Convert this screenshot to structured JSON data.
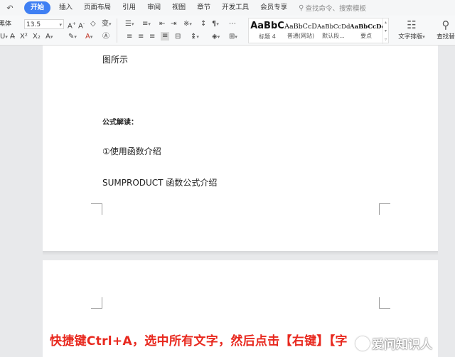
{
  "menubar": {
    "quick_icon": "↶",
    "tabs": [
      "开始",
      "插入",
      "页面布局",
      "引用",
      "审阅",
      "视图",
      "章节",
      "开发工具",
      "会员专享"
    ],
    "active_tab": "开始",
    "search_placeholder": "查找命令、搜索模板"
  },
  "ribbon": {
    "font_name": "黑体",
    "font_size": "13.5",
    "styles": [
      {
        "sample": "AaBbC",
        "name": "标题 4"
      },
      {
        "sample": "AaBbCcD",
        "name": "普通(网站)"
      },
      {
        "sample": "AaBbCcDd",
        "name": "默认段..."
      },
      {
        "sample": "AaBbCcDc",
        "name": "要点"
      }
    ],
    "text_layout_label": "文字排版",
    "find_replace_label": "查找替"
  },
  "document": {
    "lines": [
      "图所示",
      "公式解读：",
      "①使用函数介绍",
      "SUMPRODUCT 函数公式介绍"
    ]
  },
  "caption": "快捷键Ctrl+A，选中所有文字，然后点击【右键】【字",
  "watermark": "爱问知识人",
  "colors": {
    "accent": "#3f7ff3",
    "caption": "#e8281e",
    "workspace": "#e8e9eb"
  }
}
